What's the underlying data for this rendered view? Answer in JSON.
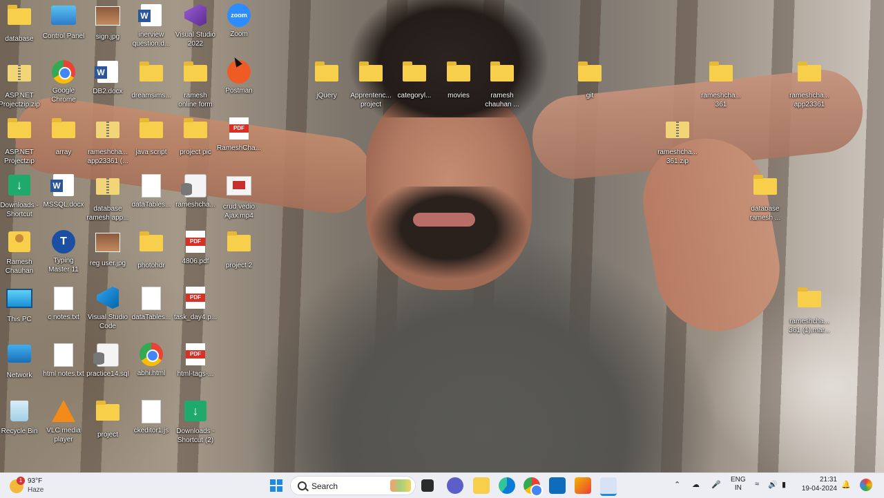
{
  "desktop": {
    "icons_col1": [
      {
        "label": "database",
        "kind": "folder"
      },
      {
        "label": "ASP.NET\nProjectzip.zip",
        "kind": "zip"
      },
      {
        "label": "ASP.NET\nProjectzip",
        "kind": "folder"
      },
      {
        "label": "Downloads -\nShortcut",
        "kind": "downloads"
      },
      {
        "label": "Ramesh\nChauhan",
        "kind": "person"
      },
      {
        "label": "This PC",
        "kind": "monitor"
      },
      {
        "label": "Network",
        "kind": "network"
      },
      {
        "label": "Recycle Bin",
        "kind": "recycle"
      }
    ],
    "icons_col2": [
      {
        "label": "Control Panel",
        "kind": "cpanel"
      },
      {
        "label": "Google\nChrome",
        "kind": "chrome"
      },
      {
        "label": "array",
        "kind": "folder"
      },
      {
        "label": "MSSQL.docx",
        "kind": "word"
      },
      {
        "label": "Typing\nMaster 11",
        "kind": "typing"
      },
      {
        "label": "c notes.txt",
        "kind": "doc"
      },
      {
        "label": "html notes.txt",
        "kind": "doc"
      },
      {
        "label": "VLC media\nplayer",
        "kind": "vlc"
      }
    ],
    "icons_col3": [
      {
        "label": "sign.jpg",
        "kind": "img"
      },
      {
        "label": "DB2.docx",
        "kind": "word"
      },
      {
        "label": "rameshcha...\napp23361 (...",
        "kind": "zip"
      },
      {
        "label": "database\nramesh app...",
        "kind": "zip"
      },
      {
        "label": "reg user.jpg",
        "kind": "img"
      },
      {
        "label": "Visual Studio\nCode",
        "kind": "vscode"
      },
      {
        "label": "practice14.sql",
        "kind": "sql"
      },
      {
        "label": "project",
        "kind": "folder"
      }
    ],
    "icons_col4": [
      {
        "label": "inerview\nquestion.d...",
        "kind": "word"
      },
      {
        "label": "dreamsims...",
        "kind": "folder"
      },
      {
        "label": "java script",
        "kind": "folder"
      },
      {
        "label": "dataTables...",
        "kind": "doc"
      },
      {
        "label": "photohdr",
        "kind": "folder"
      },
      {
        "label": "dataTables...",
        "kind": "doc"
      },
      {
        "label": "abhi.html",
        "kind": "chrome"
      },
      {
        "label": "ckeditor1.js",
        "kind": "doc"
      }
    ],
    "icons_col5": [
      {
        "label": "Visual Studio\n2022",
        "kind": "vs"
      },
      {
        "label": "ramesh\nonline form",
        "kind": "folder"
      },
      {
        "label": "project pic",
        "kind": "folder"
      },
      {
        "label": "rameshcha...",
        "kind": "sql"
      },
      {
        "label": "4806.pdf",
        "kind": "pdf"
      },
      {
        "label": "task_day4.p...",
        "kind": "pdf"
      },
      {
        "label": "html-tags-...",
        "kind": "pdf"
      },
      {
        "label": "Downloads -\nShortcut (2)",
        "kind": "downloads"
      }
    ],
    "icons_col6": [
      {
        "label": "Zoom",
        "kind": "zoom"
      },
      {
        "label": "Postman",
        "kind": "postman"
      },
      {
        "label": "RameshCha...",
        "kind": "pdf"
      },
      {
        "label": "crud vedio\nAjax.mp4",
        "kind": "video"
      },
      {
        "label": "project 2",
        "kind": "folder"
      }
    ],
    "icons_top_row": [
      {
        "label": "jQuery",
        "kind": "folder"
      },
      {
        "label": "Apprentenc...\nproject",
        "kind": "folder"
      },
      {
        "label": "categoryl...",
        "kind": "folder"
      },
      {
        "label": "movies",
        "kind": "folder"
      },
      {
        "label": "ramesh\nchauhan ...",
        "kind": "folder"
      },
      {
        "label": "git",
        "kind": "folder"
      }
    ],
    "icons_right": [
      {
        "label": "rameshcha...\n361",
        "kind": "folder"
      },
      {
        "label": "rameshcha...\napp23361",
        "kind": "folder"
      },
      {
        "label": "rameshcha...\n361.zip",
        "kind": "zip"
      },
      {
        "label": "database\nramesh ...",
        "kind": "folder"
      },
      {
        "label": "rameshcha...\n361 (1).mar...",
        "kind": "folder"
      }
    ]
  },
  "taskbar": {
    "weather_temp": "93°F",
    "weather_cond": "Haze",
    "weather_badge": "1",
    "search_placeholder": "Search",
    "lang_line1": "ENG",
    "lang_line2": "IN",
    "time": "21:31",
    "date": "19-04-2024"
  },
  "colors": {
    "folder": "#f7cf4a",
    "accent": "#1e88e5",
    "taskbar_bg": "#eceef3"
  }
}
